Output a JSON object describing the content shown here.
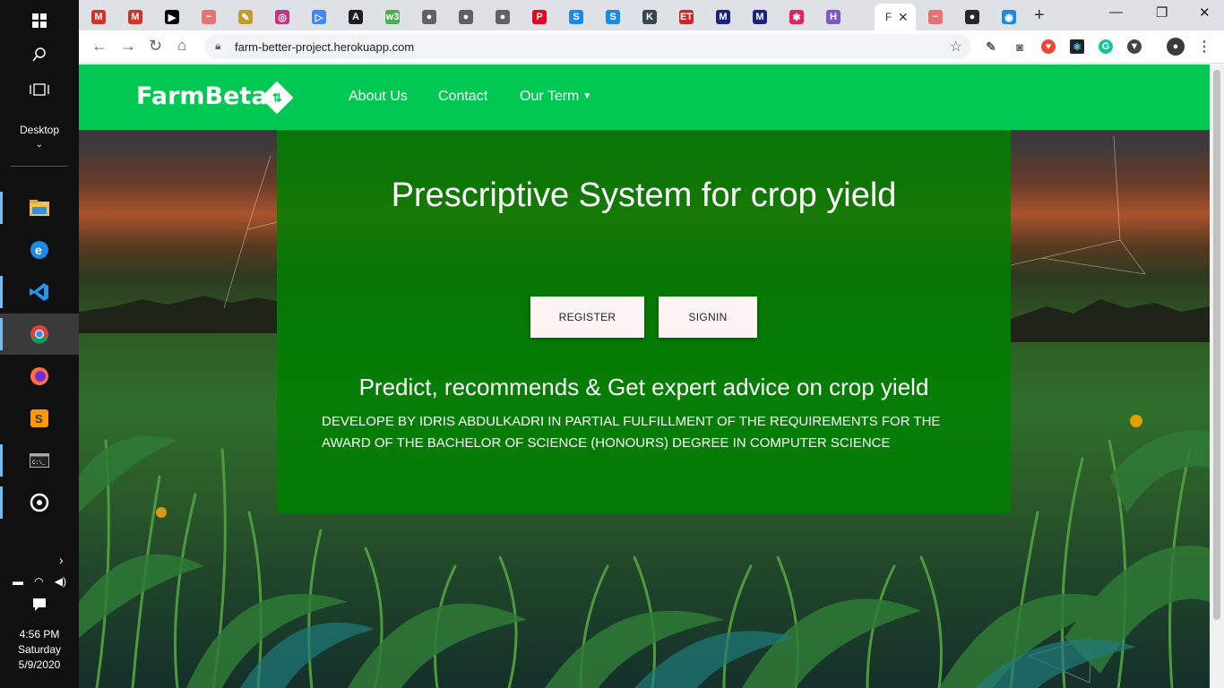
{
  "taskbar": {
    "desktop_label": "Desktop",
    "time": "4:56 PM",
    "day": "Saturday",
    "date": "5/9/2020"
  },
  "browser": {
    "active_tab_title": "F",
    "url": "farm-better-project.herokuapp.com",
    "tabs": [
      {
        "icon": "gmail-icon",
        "glyph": "M",
        "color": "#d93025"
      },
      {
        "icon": "gmail-icon",
        "glyph": "M",
        "color": "#d93025"
      },
      {
        "icon": "medium-icon",
        "glyph": "▶",
        "color": "#000000"
      },
      {
        "icon": "site-icon",
        "glyph": "~",
        "color": "#e57373"
      },
      {
        "icon": "site-icon",
        "glyph": "✎",
        "color": "#c49a2a"
      },
      {
        "icon": "instagram-icon",
        "glyph": "◎",
        "color": "#c13584"
      },
      {
        "icon": "play-icon",
        "glyph": "▷",
        "color": "#4285f4"
      },
      {
        "icon": "code-icon",
        "glyph": "A",
        "color": "#1b1f24"
      },
      {
        "icon": "w3schools-icon",
        "glyph": "w3",
        "color": "#4caf50"
      },
      {
        "icon": "globe-icon",
        "glyph": "●",
        "color": "#5f6368"
      },
      {
        "icon": "globe-icon",
        "glyph": "●",
        "color": "#5f6368"
      },
      {
        "icon": "globe-icon",
        "glyph": "●",
        "color": "#5f6368"
      },
      {
        "icon": "pinterest-icon",
        "glyph": "P",
        "color": "#e60023"
      },
      {
        "icon": "site-icon",
        "glyph": "S",
        "color": "#1e88e5"
      },
      {
        "icon": "site-icon",
        "glyph": "S",
        "color": "#1e88e5"
      },
      {
        "icon": "site-icon",
        "glyph": "K",
        "color": "#37474f"
      },
      {
        "icon": "et-icon",
        "glyph": "ET",
        "color": "#c62828"
      },
      {
        "icon": "medium-icon",
        "glyph": "M",
        "color": "#1a237e"
      },
      {
        "icon": "medium-icon",
        "glyph": "M",
        "color": "#1a237e"
      },
      {
        "icon": "site-icon",
        "glyph": "✱",
        "color": "#e91e63"
      },
      {
        "icon": "hashnode-icon",
        "glyph": "H",
        "color": "#7e57c2"
      }
    ],
    "tabs_after_active": [
      {
        "icon": "site-icon",
        "glyph": "~",
        "color": "#e57373"
      },
      {
        "icon": "github-icon",
        "glyph": "●",
        "color": "#24292e"
      },
      {
        "icon": "site-icon",
        "glyph": "◉",
        "color": "#1e88e5"
      }
    ]
  },
  "page": {
    "brand": "FarmBeta",
    "nav": {
      "about": "About Us",
      "contact": "Contact",
      "our_term": "Our Term"
    },
    "hero": {
      "title": "Prescriptive System for crop yield",
      "register_label": "REGISTER",
      "signin_label": "SIGNIN",
      "subtitle": "Predict, recommends & Get expert advice on crop yield",
      "note": "DEVELOPE BY IDRIS ABDULKADRI IN PARTIAL FULFILLMENT OF THE REQUIREMENTS FOR THE AWARD OF THE BACHELOR OF SCIENCE (HONOURS) DEGREE IN COMPUTER SCIENCE"
    }
  },
  "colors": {
    "navbar": "#00c853",
    "hero_panel": "#008000",
    "button_bg": "#fdf4f4"
  }
}
